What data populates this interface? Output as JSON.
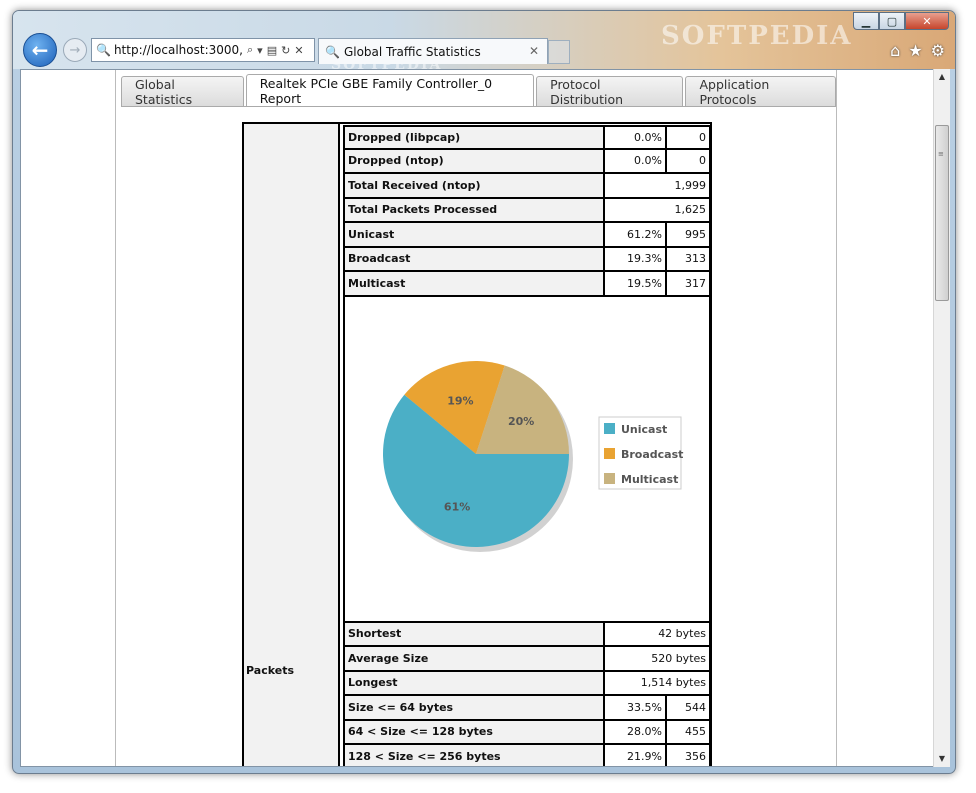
{
  "browser": {
    "url": "http://localhost:3000,",
    "tab_title": "Global Traffic Statistics",
    "tab_close": "✕",
    "watermark": "SOFTPEDIA",
    "caption": {
      "min": "▁",
      "max": "▢",
      "close": "✕"
    },
    "icons": [
      "home-icon",
      "star-icon",
      "gear-icon",
      "back-arrow-icon",
      "forward-arrow-icon",
      "search-icon",
      "refresh-icon",
      "stop-icon"
    ]
  },
  "page_tabs": [
    {
      "label": "Global Statistics",
      "active": false
    },
    {
      "label": "Realtek PCIe GBE Family Controller_0 Report",
      "active": true
    },
    {
      "label": "Protocol Distribution",
      "active": false
    },
    {
      "label": "Application Protocols",
      "active": false
    }
  ],
  "section_label": "Packets",
  "rows_top": [
    {
      "label": "Dropped (libpcap)",
      "pct": "0.0%",
      "num": "0"
    },
    {
      "label": "Dropped (ntop)",
      "pct": "0.0%",
      "num": "0"
    },
    {
      "label": "Total Received (ntop)",
      "value": "1,999"
    },
    {
      "label": "Total Packets Processed",
      "value": "1,625"
    },
    {
      "label": "Unicast",
      "pct": "61.2%",
      "num": "995"
    },
    {
      "label": "Broadcast",
      "pct": "19.3%",
      "num": "313"
    },
    {
      "label": "Multicast",
      "pct": "19.5%",
      "num": "317"
    }
  ],
  "rows_bottom": [
    {
      "label": "Shortest",
      "value": "42 bytes"
    },
    {
      "label": "Average Size",
      "value": "520 bytes"
    },
    {
      "label": "Longest",
      "value": "1,514 bytes"
    },
    {
      "label": "Size <= 64 bytes",
      "pct": "33.5%",
      "num": "544"
    },
    {
      "label": "64 < Size <= 128 bytes",
      "pct": "28.0%",
      "num": "455"
    },
    {
      "label": "128 < Size <= 256 bytes",
      "pct": "21.9%",
      "num": "356"
    }
  ],
  "chart_data": {
    "type": "pie",
    "slices": [
      {
        "name": "Unicast",
        "value": 61,
        "label": "61%",
        "color": "#4bafc6"
      },
      {
        "name": "Broadcast",
        "value": 19,
        "label": "19%",
        "color": "#e9a332"
      },
      {
        "name": "Multicast",
        "value": 20,
        "label": "20%",
        "color": "#c8b37f"
      }
    ],
    "legend": "right"
  }
}
